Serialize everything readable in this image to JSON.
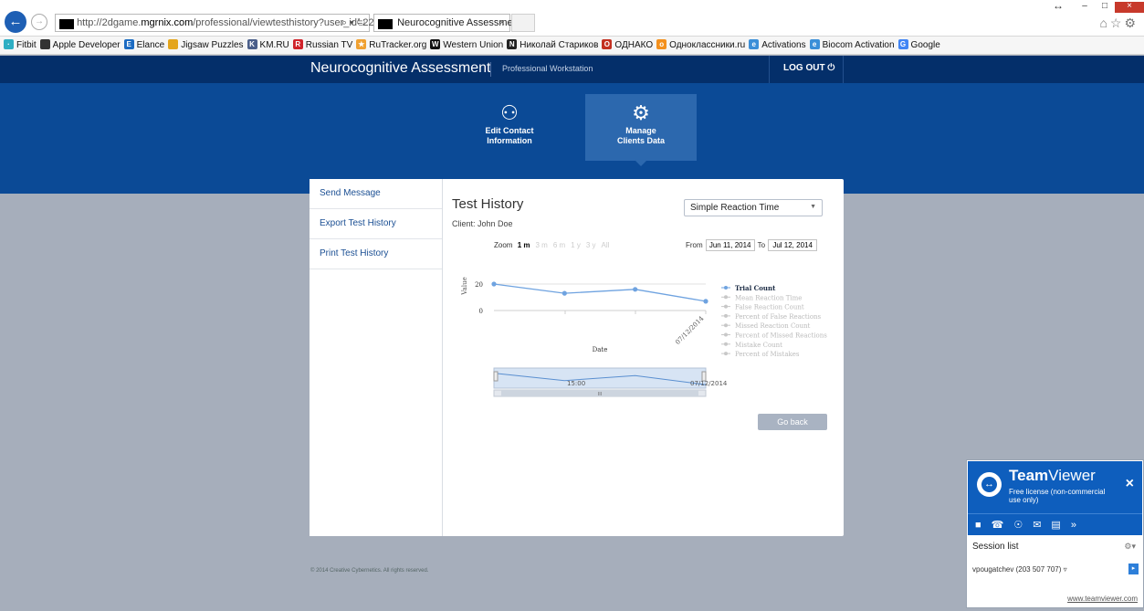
{
  "browser": {
    "url_prefix": "http://2dgame.",
    "url_domain": "mgrnix.com",
    "url_path": "/professional/viewtesthistory?user_id=22",
    "addr_tools": "⌕ ▾ ↻",
    "tab_title": "Neurocognitive Assessmen...",
    "tab_close": "×",
    "back_glyph": "←",
    "fwd_glyph": "→",
    "ie_icons": "⌂☆⚙",
    "resize_glyph": "↔",
    "min_glyph": "–",
    "max_glyph": "□",
    "close_glyph": "×"
  },
  "bookmarks": [
    {
      "label": "Fitbit",
      "icon": "fitbit-icon",
      "color": "#2eaec3",
      "glyph": "·"
    },
    {
      "label": "Apple Developer",
      "icon": "apple-icon",
      "color": "#333333",
      "glyph": ""
    },
    {
      "label": "Elance",
      "icon": "elance-icon",
      "color": "#1c6bc2",
      "glyph": "E"
    },
    {
      "label": "Jigsaw Puzzles",
      "icon": "jigsaw-icon",
      "color": "#e4a51c",
      "glyph": ""
    },
    {
      "label": "KM.RU",
      "icon": "kmru-icon",
      "color": "#4b5f8a",
      "glyph": "K"
    },
    {
      "label": "Russian TV",
      "icon": "russian-tv-icon",
      "color": "#d0232a",
      "glyph": "R"
    },
    {
      "label": "RuTracker.org",
      "icon": "rutracker-icon",
      "color": "#f0a030",
      "glyph": "★"
    },
    {
      "label": "Western Union",
      "icon": "western-union-icon",
      "color": "#111111",
      "glyph": "W"
    },
    {
      "label": "Николай Стариков",
      "icon": "starikov-icon",
      "color": "#222222",
      "glyph": "N"
    },
    {
      "label": "ОДНАКО",
      "icon": "odnako-icon",
      "color": "#c33020",
      "glyph": "O"
    },
    {
      "label": "Одноклассники.ru",
      "icon": "odnoklassniki-icon",
      "color": "#f3901d",
      "glyph": "o"
    },
    {
      "label": "Activations",
      "icon": "ie-page-icon",
      "color": "#3b8fd8",
      "glyph": "e"
    },
    {
      "label": "Biocom Activation",
      "icon": "ie-page-icon",
      "color": "#3b8fd8",
      "glyph": "e"
    },
    {
      "label": "Google",
      "icon": "google-icon",
      "color": "#4285f4",
      "glyph": "G"
    }
  ],
  "site": {
    "title": "Neurocognitive Assessment",
    "subtitle": "Professional Workstation",
    "logout": "LOG OUT ⏻"
  },
  "hero": {
    "edit_contact": {
      "line1": "Edit Contact",
      "line2": "Information",
      "icon": "user-add-icon",
      "glyph": "⚇"
    },
    "manage_clients": {
      "line1": "Manage",
      "line2": "Clients Data",
      "icon": "gears-icon",
      "glyph": "⚙"
    }
  },
  "sidebar": {
    "items": [
      {
        "label": "Send Message"
      },
      {
        "label": "Export Test History"
      },
      {
        "label": "Print Test History"
      }
    ]
  },
  "main": {
    "title": "Test History",
    "client": "Client: John Doe",
    "test_select": "Simple Reaction Time",
    "select_arrow": "▼",
    "zoom_label": "Zoom",
    "zoom_options": [
      "1 m",
      "3 m",
      "6 m",
      "1 y",
      "3 y",
      "All"
    ],
    "from_label": "From",
    "from_value": "Jun 11, 2014",
    "to_label": "To",
    "to_value": "Jul 12, 2014",
    "go_back": "Go back"
  },
  "chart_data": {
    "type": "line",
    "ylabel": "Value",
    "xlabel": "Date",
    "y_ticks": [
      "20",
      "0"
    ],
    "x_tick_label": "07/12/2014",
    "series": [
      {
        "name": "Trial Count",
        "values": [
          20,
          13,
          16,
          7
        ],
        "visible": true,
        "color": "#6fa3e0"
      }
    ],
    "legend": [
      "Trial Count",
      "Mean Reaction Time",
      "False Reaction Count",
      "Percent of False Reactions",
      "Missed Reaction Count",
      "Percent of Missed Reactions",
      "Mistake Count",
      "Percent of Mistakes"
    ],
    "navigator_labels": [
      "15:00",
      "07/12/2014"
    ],
    "navigator_scroll_label": "III",
    "legend_placement": "right"
  },
  "footer": {
    "copyright": "© 2014 Creative Cybernetics. All rights reserved."
  },
  "teamviewer": {
    "brand_bold": "Team",
    "brand_light": "Viewer",
    "license": "Free license (non-commercial use only)",
    "close": "×",
    "toolbar_icons": "■☎☉✉▤»",
    "session_list": "Session list",
    "settings_glyph": "⚙▾",
    "contact": "vpougatchev (203 507 707) ▿",
    "connect_glyph": "▸",
    "link": "www.teamviewer.com",
    "logo_glyph": "↔",
    "toggle": "›"
  }
}
